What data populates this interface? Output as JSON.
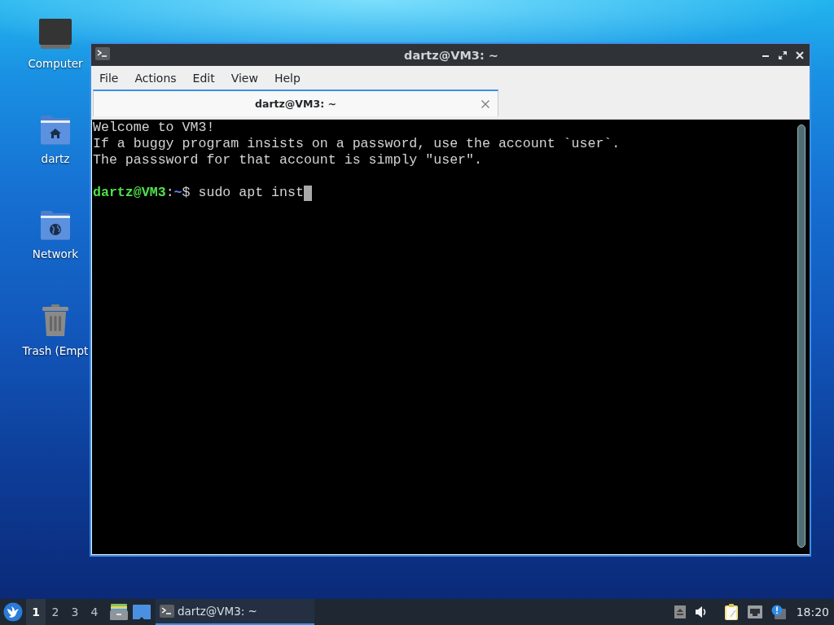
{
  "desktop": {
    "icons": [
      {
        "kind": "computer",
        "label": "Computer"
      },
      {
        "kind": "home-folder",
        "label": "dartz"
      },
      {
        "kind": "network-folder",
        "label": "Network"
      },
      {
        "kind": "trash",
        "label": "Trash (Empt"
      }
    ]
  },
  "window": {
    "title": "dartz@VM3: ~",
    "menu": [
      "File",
      "Actions",
      "Edit",
      "View",
      "Help"
    ],
    "tabs": [
      {
        "label": "dartz@VM3: ~",
        "selected": true
      }
    ],
    "terminal": {
      "output": [
        "Welcome to VM3!",
        "If a buggy program insists on a password, use the account `user`.",
        "The passsword for that account is simply \"user\"."
      ],
      "prompt": {
        "user_host": "dartz@VM3",
        "separator": ":",
        "path": "~",
        "symbol": "$"
      },
      "command": "sudo apt inst",
      "cursor": true
    }
  },
  "taskbar": {
    "workspaces": [
      {
        "label": "1",
        "selected": true
      },
      {
        "label": "2",
        "selected": false
      },
      {
        "label": "3",
        "selected": false
      },
      {
        "label": "4",
        "selected": false
      }
    ],
    "tasks": [
      {
        "label": "dartz@VM3: ~",
        "selected": true
      }
    ],
    "clock": "18:20"
  }
}
